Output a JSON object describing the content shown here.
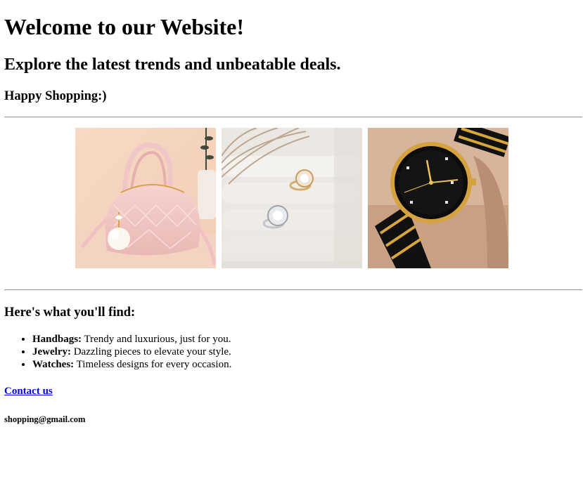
{
  "header": {
    "title": "Welcome to our Website!",
    "subtitle": "Explore the latest trends and unbeatable deals.",
    "tagline": "Happy Shopping:)"
  },
  "gallery": {
    "images": [
      {
        "icon": "handbag-photo"
      },
      {
        "icon": "rings-photo"
      },
      {
        "icon": "watch-photo"
      }
    ]
  },
  "features": {
    "heading": "Here's what you'll find:",
    "items": [
      {
        "label": "Handbags:",
        "text": "Trendy and luxurious, just for you."
      },
      {
        "label": "Jewelry:",
        "text": "Dazzling pieces to elevate your style."
      },
      {
        "label": "Watches:",
        "text": "Timeless designs for every occasion."
      }
    ]
  },
  "contact": {
    "link_label": "Contact us",
    "email": "shopping@gmail.com"
  }
}
